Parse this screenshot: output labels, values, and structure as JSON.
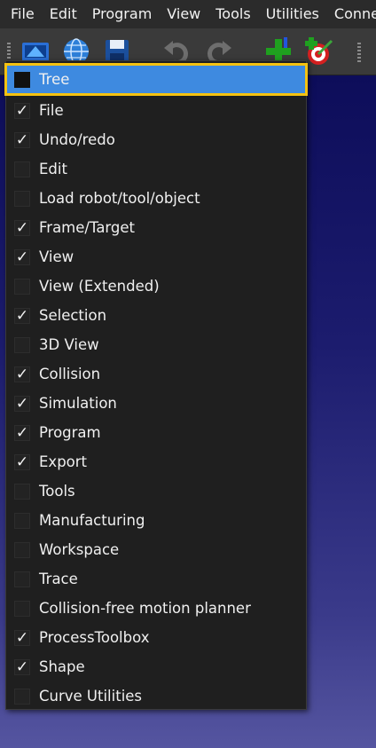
{
  "menubar": {
    "items": [
      "File",
      "Edit",
      "Program",
      "View",
      "Tools",
      "Utilities",
      "Conne"
    ]
  },
  "toolbar": {
    "icons": [
      "open-station-icon",
      "online-library-icon",
      "save-icon",
      "undo-icon",
      "redo-icon",
      "add-frame-icon",
      "add-target-icon"
    ]
  },
  "colors": {
    "highlight": "#3e8ae0",
    "focus_outline": "#f5c211",
    "menu_bg": "#1f1f1f",
    "workspace_top": "#0d0d5a",
    "workspace_bottom": "#5555a0"
  },
  "toolbar_menu": {
    "check_glyph": "✓",
    "items": [
      {
        "label": "Tree",
        "checked": false,
        "highlighted": true
      },
      {
        "label": "File",
        "checked": true
      },
      {
        "label": "Undo/redo",
        "checked": true
      },
      {
        "label": "Edit",
        "checked": false
      },
      {
        "label": "Load robot/tool/object",
        "checked": false
      },
      {
        "label": "Frame/Target",
        "checked": true
      },
      {
        "label": "View",
        "checked": true
      },
      {
        "label": "View (Extended)",
        "checked": false
      },
      {
        "label": "Selection",
        "checked": true
      },
      {
        "label": "3D View",
        "checked": false
      },
      {
        "label": "Collision",
        "checked": true
      },
      {
        "label": "Simulation",
        "checked": true
      },
      {
        "label": "Program",
        "checked": true
      },
      {
        "label": "Export",
        "checked": true
      },
      {
        "label": "Tools",
        "checked": false
      },
      {
        "label": "Manufacturing",
        "checked": false
      },
      {
        "label": "Workspace",
        "checked": false
      },
      {
        "label": "Trace",
        "checked": false
      },
      {
        "label": "Collision-free motion planner",
        "checked": false
      },
      {
        "label": "ProcessToolbox",
        "checked": true
      },
      {
        "label": "Shape",
        "checked": true
      },
      {
        "label": "Curve Utilities",
        "checked": false
      }
    ]
  }
}
